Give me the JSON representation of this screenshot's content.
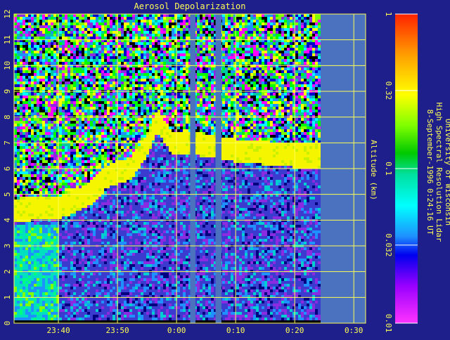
{
  "chart_data": {
    "type": "heatmap",
    "title": "Aerosol Depolarization",
    "ylabel": "Altitude (km)",
    "x_tick_labels": [
      "23:40",
      "23:50",
      "0:00",
      "0:10",
      "0:20",
      "0:30"
    ],
    "y_ticks": [
      0,
      1,
      2,
      3,
      4,
      5,
      6,
      7,
      8,
      9,
      10,
      11,
      12
    ],
    "ylim": [
      0,
      12
    ],
    "xlim_minutes": [
      -27.5,
      32
    ],
    "data_end_minutes": 24,
    "gaps_minutes": [
      [
        2.3,
        3.2
      ],
      [
        6.6,
        7.6
      ]
    ],
    "layer_top_km": [
      {
        "t": -27.5,
        "z": 4.9
      },
      {
        "t": -20,
        "z": 5.0
      },
      {
        "t": -15,
        "z": 5.5
      },
      {
        "t": -12,
        "z": 6.2
      },
      {
        "t": -8,
        "z": 6.5
      },
      {
        "t": -5,
        "z": 7.5
      },
      {
        "t": -3.5,
        "z": 8.4
      },
      {
        "t": -1,
        "z": 7.5
      },
      {
        "t": 2,
        "z": 7.5
      },
      {
        "t": 10,
        "z": 7.2
      },
      {
        "t": 20,
        "z": 7.0
      },
      {
        "t": 24,
        "z": 7.0
      }
    ],
    "colorbar": {
      "scale": "log",
      "range": [
        0.01,
        1
      ],
      "tick_labels": [
        "0.01",
        "0.032",
        "0.1",
        "0.32",
        "1"
      ]
    },
    "annotation_lines": [
      "University of Wisconsin",
      "High Spectral Resolution Lidar",
      " 8-September-1996  0:24:16 UT"
    ],
    "colors": {
      "background": "#1f1f8c",
      "grid": "#ffff55",
      "text": "#ffff55",
      "no_data": "#4a72bf",
      "layer": "#f5f500"
    },
    "grid": true
  }
}
